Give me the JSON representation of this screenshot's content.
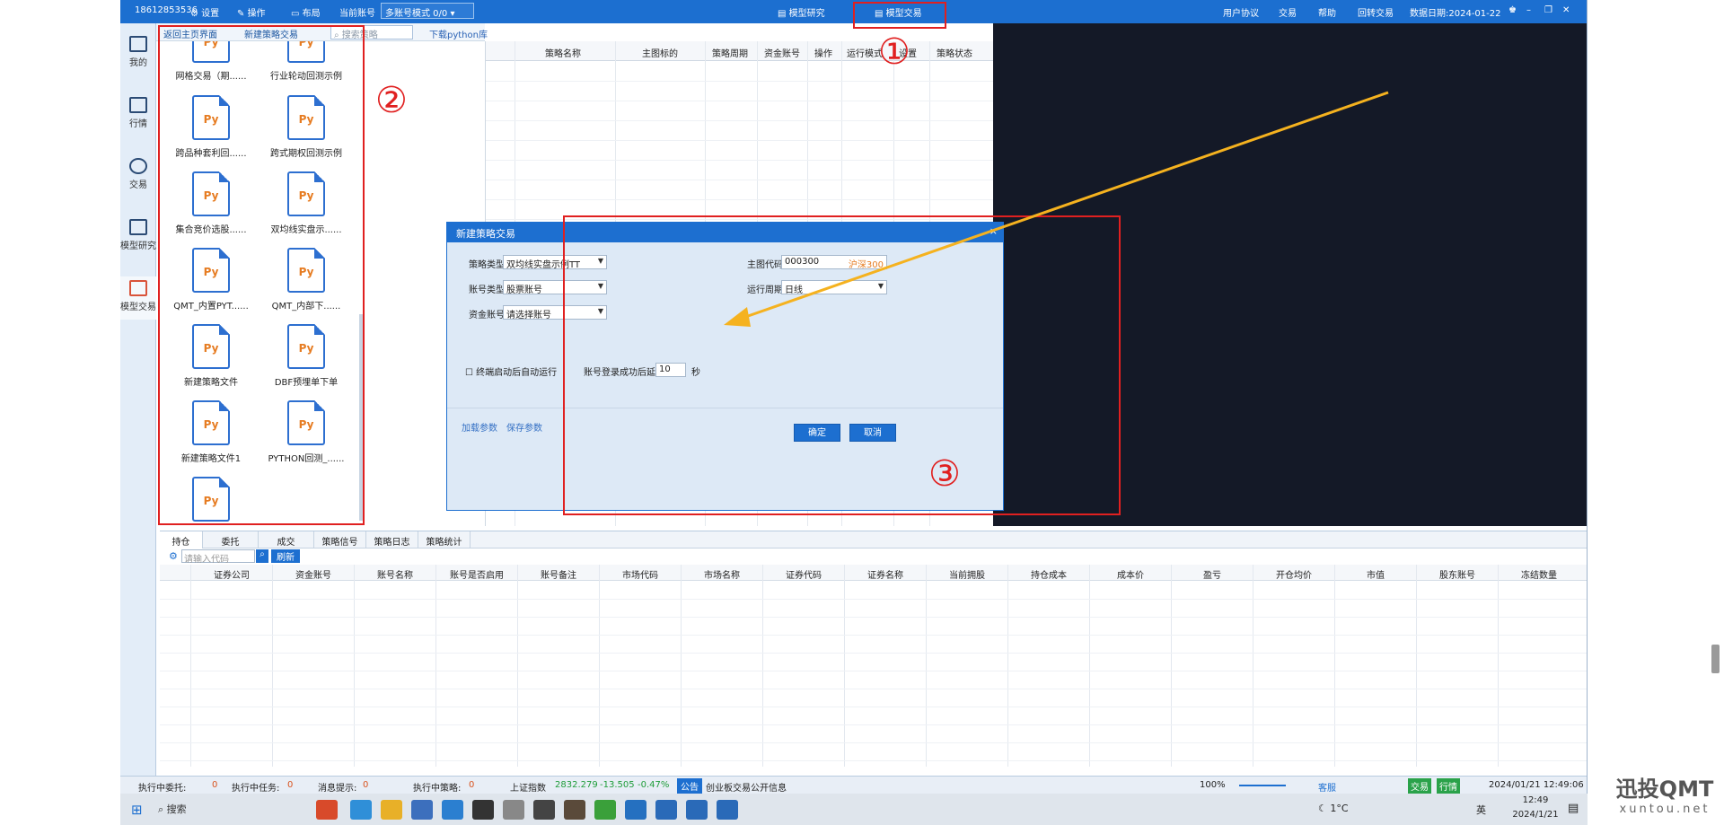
{
  "titlebar": {
    "phone": "18612853536",
    "settings": "设置",
    "operations": "操作",
    "layout": "布局",
    "current_account": "当前账号",
    "account_mode": "多账号模式 0/0",
    "model_research": "模型研究",
    "model_trading": "模型交易",
    "user_agreement": "用户协议",
    "trade": "交易",
    "help": "帮助",
    "back_trade": "回转交易",
    "data_date": "数据日期:2024-01-22"
  },
  "nav": [
    {
      "label": "我的",
      "icon": "home-icon"
    },
    {
      "label": "行情",
      "icon": "chart-icon"
    },
    {
      "label": "交易",
      "icon": "trade-icon"
    },
    {
      "label": "模型研究",
      "icon": "research-icon"
    },
    {
      "label": "模型交易",
      "icon": "model-trade-icon"
    }
  ],
  "sub": {
    "back": "返回主页界面",
    "new": "新建策略交易",
    "search_ph": "搜索策略",
    "download": "下载python库"
  },
  "files": [
    {
      "name": "网格交易（期......"
    },
    {
      "name": "行业轮动回测示例"
    },
    {
      "name": "跨品种套利回......"
    },
    {
      "name": "跨式期权回测示例"
    },
    {
      "name": "集合竞价选股......"
    },
    {
      "name": "双均线实盘示......"
    },
    {
      "name": "QMT_内置PYT......"
    },
    {
      "name": "QMT_内部下......"
    },
    {
      "name": "新建策略文件"
    },
    {
      "name": "DBF预埋单下单"
    },
    {
      "name": "新建策略文件1"
    },
    {
      "name": "PYTHON回测_......"
    },
    {
      "name": ""
    }
  ],
  "py": "Py",
  "grid_headers": [
    "策略名称",
    "主图标的",
    "策略周期",
    "资金账号",
    "操作",
    "运行模式",
    "设置",
    "策略状态"
  ],
  "dialog": {
    "title": "新建策略交易",
    "close": "×",
    "strategy_type_lbl": "策略类型",
    "strategy_type": "双均线实盘示例TT",
    "account_type_lbl": "账号类型",
    "account_type": "股票账号",
    "fund_account_lbl": "资金账号",
    "fund_account": "请选择账号",
    "main_code_lbl": "主图代码",
    "main_code": "000300",
    "main_code_name": "沪深300",
    "period_lbl": "运行周期",
    "period": "日线",
    "autorun": "终端启动后自动运行",
    "delay_lbl": "账号登录成功后延迟",
    "delay": "10",
    "delay_unit": "秒",
    "load_params": "加载参数",
    "save_params": "保存参数",
    "ok": "确定",
    "cancel": "取消"
  },
  "annotations": {
    "c1": "①",
    "c2": "②",
    "c3": "③"
  },
  "bottom": {
    "tabs": [
      "持仓",
      "委托",
      "成交",
      "策略信号",
      "策略日志",
      "策略统计"
    ],
    "code_ph": "请输入代码",
    "refresh": "刷新",
    "headers": [
      "证券公司",
      "资金账号",
      "账号名称",
      "账号是否启用",
      "账号备注",
      "市场代码",
      "市场名称",
      "证券代码",
      "证券名称",
      "当前拥股",
      "持仓成本",
      "成本价",
      "盈亏",
      "开仓均价",
      "市值",
      "股东账号",
      "冻结数量"
    ]
  },
  "status": {
    "exec_orders": "执行中委托:",
    "exec_orders_v": "0",
    "exec_tasks": "执行中任务:",
    "exec_tasks_v": "0",
    "msg": "消息提示:",
    "msg_v": "0",
    "exec_strat": "执行中策略:",
    "exec_strat_v": "0",
    "index_name": "上证指数",
    "index_v": "2832.279",
    "index_chg": "-13.505",
    "index_pct": "-0.47%",
    "notice_tag": "公告",
    "notice": "创业板交易公开信息",
    "zoom": "100%",
    "service": "客服",
    "trade_tag": "交易",
    "quote_tag": "行情",
    "datetime": "2024/01/21 12:49:06"
  },
  "taskbar": {
    "search": "搜索",
    "weather": "1°C",
    "lang": "英",
    "time": "12:49",
    "date": "2024/1/21"
  },
  "watermark": {
    "cn": "迅投QMT",
    "url": "xuntou.net"
  },
  "colors": {
    "accent": "#1d6fd0",
    "annotation": "#e02020",
    "arrow": "#f5b21f",
    "chart_bg": "#141927"
  }
}
